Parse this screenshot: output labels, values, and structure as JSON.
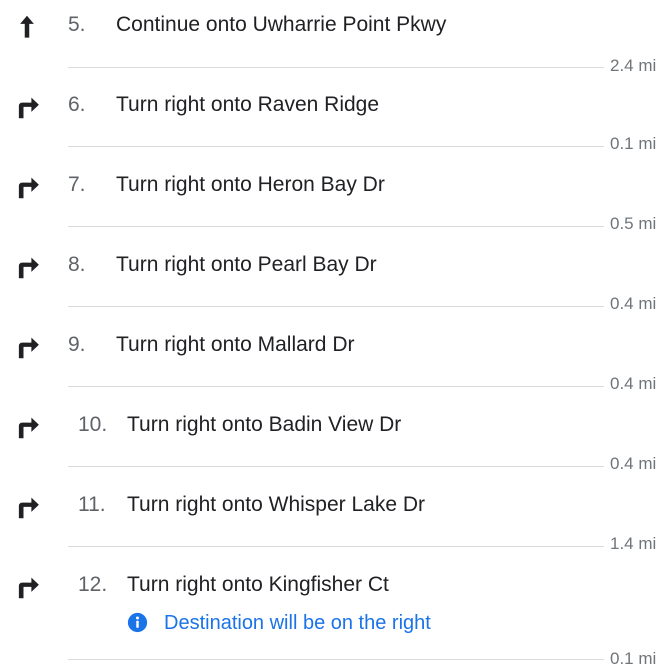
{
  "colors": {
    "icon": "#202124",
    "number": "#5f6368",
    "text": "#202124",
    "divider": "#dadce0",
    "distance": "#70757a",
    "note": "#1a73e8"
  },
  "steps": [
    {
      "number": "5.",
      "instruction": "Continue onto Uwharrie Point Pkwy",
      "icon": "straight-arrow-icon",
      "distance": "2.4 mi"
    },
    {
      "number": "6.",
      "instruction": "Turn right onto Raven Ridge",
      "icon": "turn-right-icon",
      "distance": "0.1 mi"
    },
    {
      "number": "7.",
      "instruction": "Turn right onto Heron Bay Dr",
      "icon": "turn-right-icon",
      "distance": "0.5 mi"
    },
    {
      "number": "8.",
      "instruction": "Turn right onto Pearl Bay Dr",
      "icon": "turn-right-icon",
      "distance": "0.4 mi"
    },
    {
      "number": "9.",
      "instruction": "Turn right onto Mallard Dr",
      "icon": "turn-right-icon",
      "distance": "0.4 mi"
    },
    {
      "number": "10.",
      "instruction": "Turn right onto Badin View Dr",
      "icon": "turn-right-icon",
      "distance": "0.4 mi"
    },
    {
      "number": "11.",
      "instruction": "Turn right onto Whisper Lake Dr",
      "icon": "turn-right-icon",
      "distance": "1.4 mi"
    },
    {
      "number": "12.",
      "instruction": "Turn right onto Kingfisher Ct",
      "icon": "turn-right-icon",
      "distance": "0.1 mi",
      "note": {
        "text": "Destination will be on the right",
        "icon": "info-icon"
      }
    }
  ]
}
